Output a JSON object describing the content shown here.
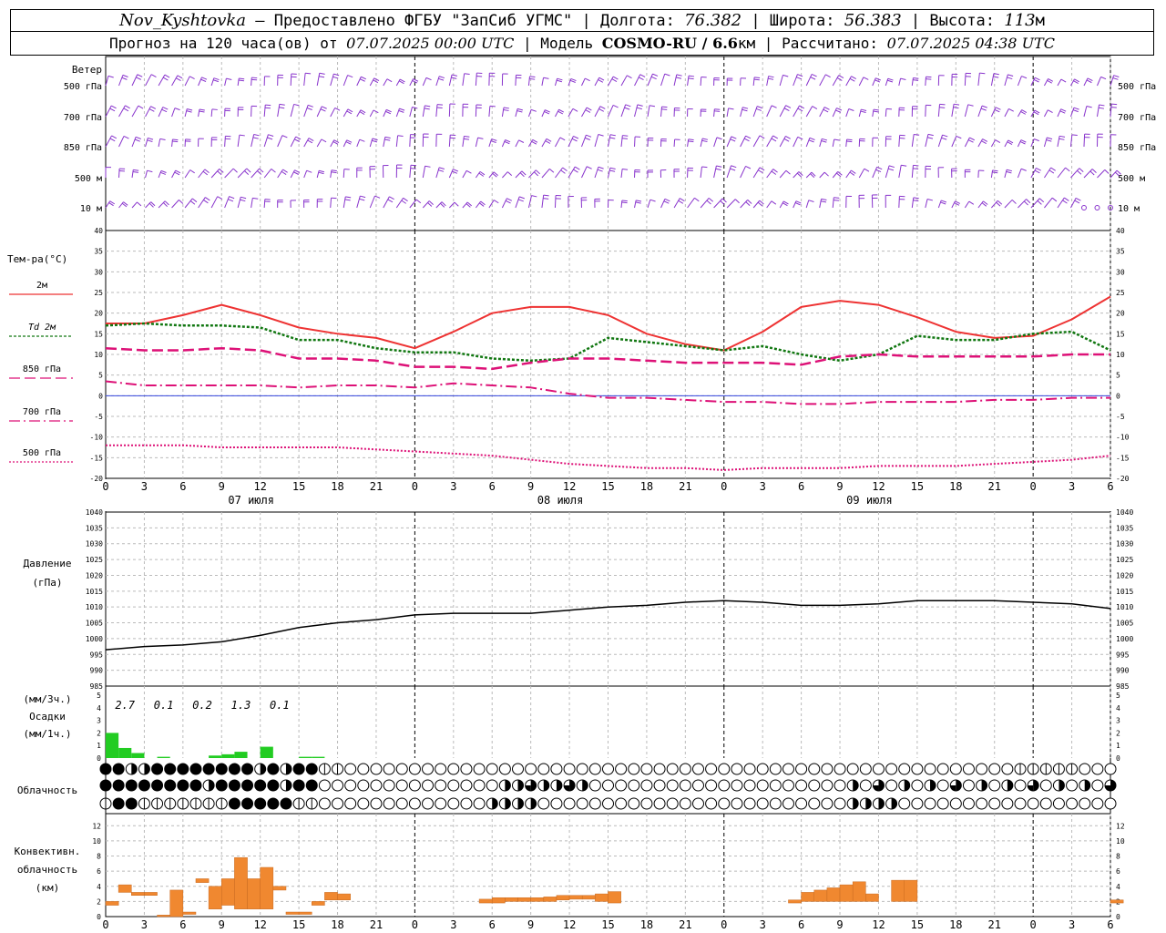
{
  "header": {
    "station": "Nov_Kyshtovka",
    "provider": " — Предоставлено ФГБУ \"ЗапСиб УГМС\" | ",
    "lon_label": "Долгота: ",
    "lon": "76.382",
    "lat_label": " | Широта: ",
    "lat": "56.383",
    "alt_label": " | Высота: ",
    "alt": "113",
    "alt_unit": "м",
    "forecast_label": "Прогноз на 120 часа(ов) от ",
    "start_time": "07.07.2025 00:00 UTC",
    "model_label": " | Модель ",
    "model": "COSMO-RU / 6.6",
    "model_unit": "км",
    "computed_label": " | Рассчитано: ",
    "computed_time": "07.07.2025 04:38 UTC"
  },
  "wind_panel": {
    "title": "Ветер",
    "levels": [
      "500 гПа",
      "700 гПа",
      "850 гПа",
      "500 м",
      "10   м"
    ]
  },
  "temp_panel": {
    "title": "Тем-ра(°C)",
    "legend": [
      {
        "label": "2м",
        "color": "#ee3333"
      },
      {
        "label": "Td 2м",
        "color": "#117711"
      },
      {
        "label": "850 гПа",
        "color": "#dd1177"
      },
      {
        "label": "700 гПа",
        "color": "#dd1177"
      },
      {
        "label": "500 гПа",
        "color": "#dd1177"
      }
    ],
    "yticks": [
      "40",
      "35",
      "30",
      "25",
      "20",
      "15",
      "10",
      "5",
      "0",
      "-5",
      "-10",
      "-15",
      "-20"
    ]
  },
  "date_labels": [
    "07 июля",
    "08 июля",
    "09 июля"
  ],
  "x_hour_labels": [
    "0",
    "3",
    "6",
    "9",
    "12",
    "15",
    "18",
    "21",
    "0",
    "3",
    "6",
    "9",
    "12",
    "15",
    "18",
    "21",
    "0",
    "3",
    "6",
    "9",
    "12",
    "15",
    "18",
    "21",
    "0",
    "3",
    "6"
  ],
  "pressure_panel": {
    "title": "Давление",
    "unit": "(гПа)",
    "yticks": [
      "1040",
      "1035",
      "1030",
      "1025",
      "1020",
      "1015",
      "1010",
      "1005",
      "1000",
      "995",
      "990",
      "985"
    ]
  },
  "precip_panel": {
    "title_top": "(мм/3ч.)",
    "title": "Осадки",
    "title_bottom": "(мм/1ч.)",
    "yticks": [
      "5",
      "4",
      "3",
      "2",
      "1",
      "0"
    ],
    "totals": [
      "2.7",
      "0.1",
      "0.2",
      "1.3",
      "0.1"
    ]
  },
  "cloud_panel": {
    "title": "Облачность"
  },
  "conv_panel": {
    "title1": "Конвективн.",
    "title2": "облачность",
    "title3": "(км)",
    "yticks": [
      "12",
      "10",
      "8",
      "6",
      "4",
      "2",
      "0"
    ]
  },
  "colors": {
    "wind": "#8833cc",
    "zero_line": "#3344dd",
    "precip": "#22cc22",
    "convective": "#f08830",
    "pressure": "#000000"
  },
  "chart_data": [
    {
      "type": "line",
      "ylabel": "Тем-ра(°C)",
      "ylim": [
        -20,
        40
      ],
      "x_hours": [
        0,
        3,
        6,
        9,
        12,
        15,
        18,
        21,
        24,
        27,
        30,
        33,
        36,
        39,
        42,
        45,
        48,
        51,
        54,
        57,
        60,
        63,
        66,
        69,
        72,
        75,
        78
      ],
      "series": [
        {
          "name": "2м",
          "values": [
            17.5,
            17.5,
            19.5,
            22,
            19.5,
            16.5,
            15,
            14,
            11.5,
            15.5,
            20,
            21.5,
            21.5,
            19.5,
            15,
            12.5,
            11,
            15.5,
            21.5,
            23,
            22,
            19,
            15.5,
            14,
            14.5,
            18.5,
            24
          ]
        },
        {
          "name": "Td 2м",
          "values": [
            17,
            17.5,
            17,
            17,
            16.5,
            13.5,
            13.5,
            11.5,
            10.5,
            10.5,
            9,
            8.5,
            9,
            14,
            13,
            12,
            11,
            12,
            10,
            8.5,
            10,
            14.5,
            13.5,
            13.5,
            15,
            15.5,
            11
          ]
        },
        {
          "name": "850 гПа",
          "values": [
            11.5,
            11,
            11,
            11.5,
            11,
            9,
            9,
            8.5,
            7,
            7,
            6.5,
            8,
            9,
            9,
            8.5,
            8,
            8,
            8,
            7.5,
            9.5,
            10,
            9.5,
            9.5,
            9.5,
            9.5,
            10,
            10
          ]
        },
        {
          "name": "700 гПа",
          "values": [
            3.5,
            2.5,
            2.5,
            2.5,
            2.5,
            2,
            2.5,
            2.5,
            2,
            3,
            2.5,
            2,
            0.5,
            -0.5,
            -0.5,
            -1,
            -1.5,
            -1.5,
            -2,
            -2,
            -1.5,
            -1.5,
            -1.5,
            -1,
            -1,
            -0.5,
            -0.5
          ]
        },
        {
          "name": "500 гПа",
          "values": [
            -12,
            -12,
            -12,
            -12.5,
            -12.5,
            -12.5,
            -12.5,
            -13,
            -13.5,
            -14,
            -14.5,
            -15.5,
            -16.5,
            -17,
            -17.5,
            -17.5,
            -18,
            -17.5,
            -17.5,
            -17.5,
            -17,
            -17,
            -17,
            -16.5,
            -16,
            -15.5,
            -14.5
          ]
        }
      ]
    },
    {
      "type": "line",
      "ylabel": "Давление (гПа)",
      "ylim": [
        985,
        1040
      ],
      "x_hours": [
        0,
        3,
        6,
        9,
        12,
        15,
        18,
        21,
        24,
        27,
        30,
        33,
        36,
        39,
        42,
        45,
        48,
        51,
        54,
        57,
        60,
        63,
        66,
        69,
        72,
        75,
        78
      ],
      "series": [
        {
          "name": "",
          "values": [
            996.5,
            997.5,
            998,
            999,
            1001,
            1003.5,
            1005,
            1006,
            1007.5,
            1008,
            1008,
            1008,
            1009,
            1010,
            1010.5,
            1011.5,
            1012,
            1011.5,
            1010.5,
            1010.5,
            1011,
            1012,
            1012,
            1012,
            1011.5,
            1011,
            1009.5
          ]
        }
      ]
    },
    {
      "type": "bar",
      "ylabel": "Осадки (мм/1ч.)",
      "ylim": [
        0,
        5
      ],
      "x_hours": [
        0,
        1,
        2,
        3,
        4,
        5,
        6,
        7,
        8,
        9,
        10,
        11,
        12,
        13,
        14,
        15,
        16,
        17,
        18
      ],
      "values": [
        2,
        0.8,
        0.4,
        0,
        0.1,
        0,
        0,
        0,
        0.2,
        0.3,
        0.5,
        0,
        0.9,
        0,
        0,
        0.1,
        0.1,
        0,
        0
      ]
    },
    {
      "type": "bar",
      "ylabel": "Конвективн. облачность (км)",
      "ylim": [
        0,
        13
      ],
      "bars": [
        {
          "x": 0,
          "bottom": 1.5,
          "top": 2
        },
        {
          "x": 1,
          "bottom": 3.2,
          "top": 4.2
        },
        {
          "x": 2,
          "bottom": 2.8,
          "top": 3.2
        },
        {
          "x": 3,
          "bottom": 2.8,
          "top": 3.2
        },
        {
          "x": 4,
          "bottom": 0,
          "top": 0.2
        },
        {
          "x": 5,
          "bottom": 0,
          "top": 3.5
        },
        {
          "x": 6,
          "bottom": 0.3,
          "top": 0.6
        },
        {
          "x": 7,
          "bottom": 4.5,
          "top": 5
        },
        {
          "x": 8,
          "bottom": 1,
          "top": 4
        },
        {
          "x": 9,
          "bottom": 1.5,
          "top": 5
        },
        {
          "x": 10,
          "bottom": 1,
          "top": 7.8
        },
        {
          "x": 11,
          "bottom": 1,
          "top": 5
        },
        {
          "x": 12,
          "bottom": 1,
          "top": 6.5
        },
        {
          "x": 13,
          "bottom": 3.5,
          "top": 4
        },
        {
          "x": 14,
          "bottom": 0.3,
          "top": 0.6
        },
        {
          "x": 15,
          "bottom": 0.3,
          "top": 0.6
        },
        {
          "x": 16,
          "bottom": 1.5,
          "top": 2
        },
        {
          "x": 17,
          "bottom": 2.2,
          "top": 3.2
        },
        {
          "x": 18,
          "bottom": 2.2,
          "top": 3
        },
        {
          "x": 29,
          "bottom": 1.8,
          "top": 2.3
        },
        {
          "x": 30,
          "bottom": 1.8,
          "top": 2.5
        },
        {
          "x": 31,
          "bottom": 2,
          "top": 2.5
        },
        {
          "x": 32,
          "bottom": 2,
          "top": 2.5
        },
        {
          "x": 33,
          "bottom": 2,
          "top": 2.5
        },
        {
          "x": 34,
          "bottom": 2,
          "top": 2.6
        },
        {
          "x": 35,
          "bottom": 2.2,
          "top": 2.8
        },
        {
          "x": 36,
          "bottom": 2.3,
          "top": 2.8
        },
        {
          "x": 37,
          "bottom": 2.3,
          "top": 2.8
        },
        {
          "x": 38,
          "bottom": 2,
          "top": 3
        },
        {
          "x": 39,
          "bottom": 1.8,
          "top": 3.3
        },
        {
          "x": 53,
          "bottom": 1.8,
          "top": 2.2
        },
        {
          "x": 54,
          "bottom": 2,
          "top": 3.2
        },
        {
          "x": 55,
          "bottom": 2,
          "top": 3.5
        },
        {
          "x": 56,
          "bottom": 2,
          "top": 3.8
        },
        {
          "x": 57,
          "bottom": 2,
          "top": 4.2
        },
        {
          "x": 58,
          "bottom": 2,
          "top": 4.6
        },
        {
          "x": 59,
          "bottom": 2,
          "top": 3
        },
        {
          "x": 61,
          "bottom": 2,
          "top": 4.8
        },
        {
          "x": 62,
          "bottom": 2,
          "top": 4.8
        },
        {
          "x": 78,
          "bottom": 1.8,
          "top": 2.2
        }
      ]
    }
  ]
}
